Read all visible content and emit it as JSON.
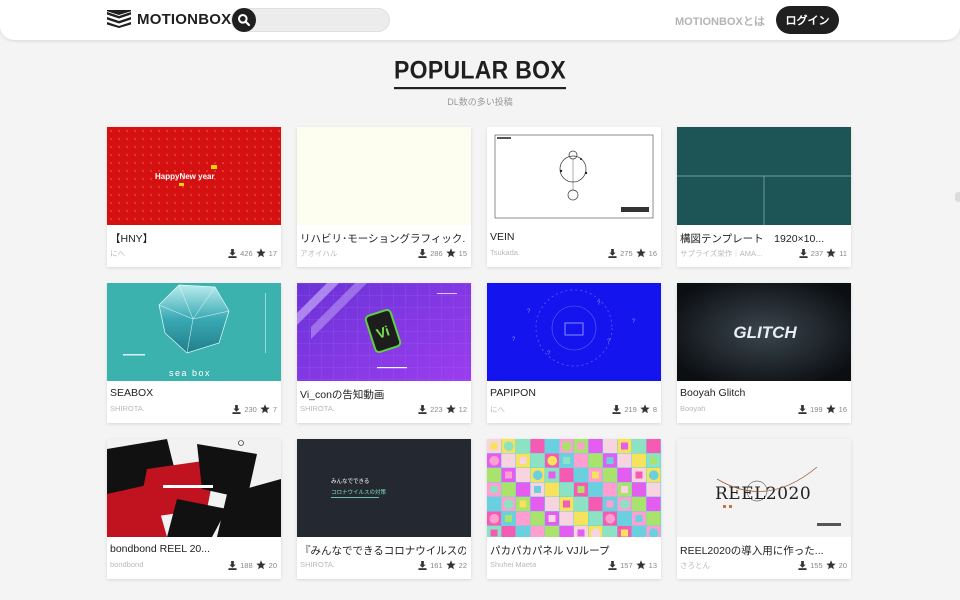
{
  "header": {
    "logo_text": "MOTIONBOX",
    "search_placeholder": "",
    "about_link": "MOTIONBOXとは",
    "login_label": "ログイン"
  },
  "section": {
    "title": "POPULAR BOX",
    "subtitle": "DL数の多い投稿"
  },
  "cards": [
    {
      "title": "【HNY】",
      "author": "にへ",
      "downloads": "426",
      "stars": "17",
      "thumb_text": "HappyNew year"
    },
    {
      "title": "リハビリ･モーショングラフィック...",
      "author": "アオイハル",
      "downloads": "286",
      "stars": "15"
    },
    {
      "title": "VEIN",
      "author": "Tsukada.",
      "downloads": "275",
      "stars": "16"
    },
    {
      "title": "構図テンプレート　1920×10...",
      "author": "サプライズ栄作｜AMA...",
      "downloads": "237",
      "stars": "11"
    },
    {
      "title": "SEABOX",
      "author": "SHIROTA.",
      "downloads": "230",
      "stars": "7",
      "thumb_text": "sea box"
    },
    {
      "title": "Vi_conの告知動画",
      "author": "SHIROTA.",
      "downloads": "223",
      "stars": "12"
    },
    {
      "title": "PAPIPON",
      "author": "にへ",
      "downloads": "219",
      "stars": "8"
    },
    {
      "title": "Booyah Glitch",
      "author": "Booyah",
      "downloads": "199",
      "stars": "16",
      "thumb_text": "GLITCH"
    },
    {
      "title": "bondbond REEL 20...",
      "author": "bondbond",
      "downloads": "188",
      "stars": "20"
    },
    {
      "title": "『みんなでできるコロナウイルスの...",
      "author": "SHIROTA.",
      "downloads": "161",
      "stars": "22",
      "thumb_text": "みんなでできる",
      "thumb_text2": "コロナウイルスの対策"
    },
    {
      "title": "パカパカパネル VJループ",
      "author": "Shuhei Maeta",
      "downloads": "157",
      "stars": "13"
    },
    {
      "title": "REEL2020の導入用に作った...",
      "author": "さろとん",
      "downloads": "155",
      "stars": "20",
      "thumb_text": "REEL2020"
    }
  ],
  "icons": {
    "logo": "stacked-layers-icon",
    "search": "search-icon",
    "download": "download-icon",
    "star": "star-icon"
  },
  "colors": {
    "brand_dark": "#1f1f1f",
    "background": "#f4f4f4"
  }
}
